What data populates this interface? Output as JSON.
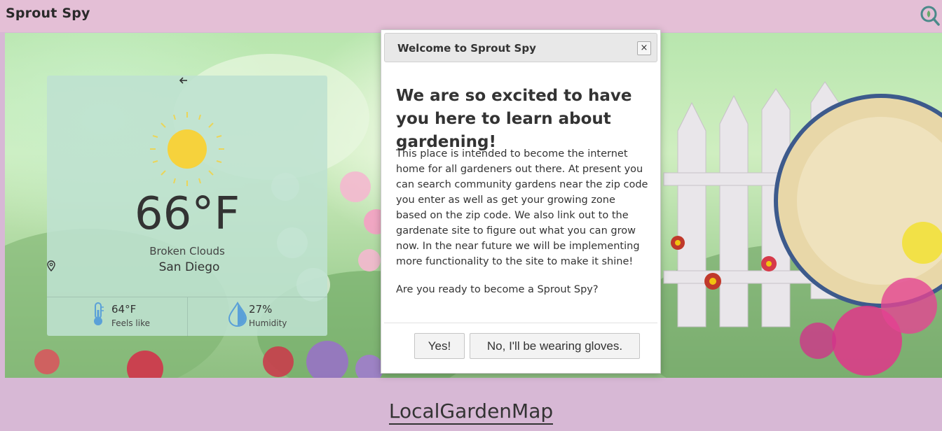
{
  "app": {
    "title": "Sprout Spy"
  },
  "header": {
    "search_icon": "search-icon"
  },
  "weather": {
    "back_icon": "arrow-left-icon",
    "weather_icon": "sun-icon",
    "temperature": "66°F",
    "condition": "Broken Clouds",
    "location": "San Diego",
    "feels_like_value": "64°F",
    "feels_like_label": "Feels like",
    "humidity_value": "27%",
    "humidity_label": "Humidity"
  },
  "modal": {
    "title": "Welcome to Sprout Spy",
    "close_label": "×",
    "heading": "We are so excited to have you here to learn about gardening!",
    "body": "This place is intended to become the internet home for all gardeners out there. At present you can search community gardens near the zip code you enter as well as get your growing zone based on the zip code. We also link out to the gardenate site to figure out what you can grow now. In the near future we will be implementing more functionality to the site to make it shine!",
    "question": "Are you ready to become a Sprout Spy?",
    "yes_label": "Yes!",
    "no_label": "No, I'll be wearing gloves."
  },
  "page": {
    "map_link": "LocalGardenMap"
  },
  "colors": {
    "header_bg": "#e4bfd6",
    "page_bg": "#d7b8d5",
    "weather_card_bg": "#bee1d0",
    "sun": "#f6d23c",
    "thermometer": "#5aa0d8"
  }
}
